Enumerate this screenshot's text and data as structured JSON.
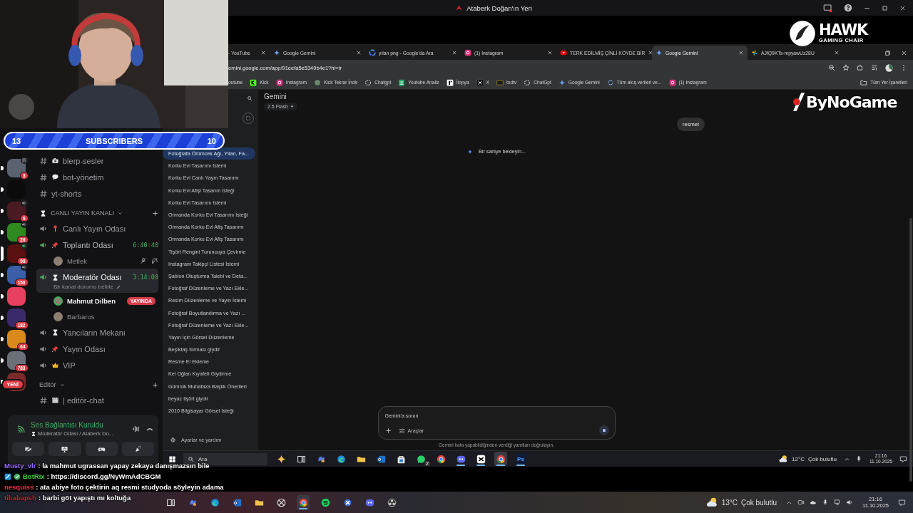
{
  "title_bar": {
    "title": "Ataberk Doğan'ın Yeri"
  },
  "subscribers_bar": {
    "left_count": "13",
    "label": "SUBSCRIBERS",
    "right_count": "10"
  },
  "sponsor_logos": [
    {
      "kind": "hawk",
      "name": "HAWK",
      "tagline": "GAMING CHAIR"
    },
    {
      "kind": "bynogame",
      "name": "ByNoGame"
    }
  ],
  "browser": {
    "tabs": [
      {
        "title": "- YouTube",
        "selected": false
      },
      {
        "title": "Google Gemini",
        "icon": {
          "kind": "gemini"
        },
        "selected": false
      },
      {
        "title": "yılan png - Google'da Ara",
        "icon": {
          "kind": "google"
        },
        "selected": false
      },
      {
        "title": "(1) Instagram",
        "icon": {
          "kind": "instagram"
        },
        "selected": false
      },
      {
        "title": "TERK EDİLMİŞ ÇİNLİ KÖYDE BİR",
        "icon": {
          "kind": "youtube"
        },
        "selected": false
      },
      {
        "title": "Google Gemini",
        "icon": {
          "kind": "gemini"
        },
        "selected": true
      },
      {
        "title": "AJfQ9KTs-mpyawUz28U",
        "icon": {
          "kind": "photos"
        },
        "selected": false
      }
    ],
    "url": "emini.google.com/app/91eefa5e5349b4e1?hl=tr",
    "bookmarks": [
      {
        "label": "outube"
      },
      {
        "label": "Kick",
        "icon": {
          "kind": "kick"
        }
      },
      {
        "label": "Instagram",
        "icon": {
          "kind": "instagram"
        }
      },
      {
        "label": "Kick Tekrar İndir",
        "icon": {
          "kind": "circle"
        }
      },
      {
        "label": "Chatgpt",
        "icon": {
          "kind": "chatgpt"
        }
      },
      {
        "label": "Youtube Analiz",
        "icon": {
          "kind": "sheets"
        }
      },
      {
        "label": "İtopya",
        "icon": {
          "kind": "itopya"
        }
      },
      {
        "label": "X",
        "icon": {
          "kind": "x"
        }
      },
      {
        "label": "todtv",
        "icon": {
          "kind": "todtv"
        }
      },
      {
        "label": "ChatGpt",
        "icon": {
          "kind": "chatgpt"
        }
      },
      {
        "label": "Google Gemini",
        "icon": {
          "kind": "gemini"
        }
      },
      {
        "label": "Tüm akış verileri ve...",
        "icon": {
          "kind": "sync"
        }
      },
      {
        "label": "(1) Instagram",
        "icon": {
          "kind": "instagram"
        }
      }
    ],
    "all_bookmarks": "Tüm Yer İşaretleri"
  },
  "discord": {
    "servers": [
      {
        "color": "#5b6270",
        "badge": "3",
        "indicator": {
          "kind": "screen"
        },
        "unread": true,
        "selected": false
      },
      {
        "color": "#0b0b0b",
        "unread": true,
        "selected": false
      },
      {
        "color": "#4a1a22",
        "badge": "6",
        "indicator": {
          "kind": "speaker"
        },
        "unread": true,
        "selected": false
      },
      {
        "color": "#2f8a1f",
        "badge": "26",
        "indicator": {
          "kind": "speaker"
        },
        "unread": true,
        "selected": false
      },
      {
        "color": "#5a1010",
        "badge": "98",
        "indicator": {
          "kind": "speaker-active"
        },
        "unread": false,
        "selected": true
      },
      {
        "color": "#3a5fa8",
        "badge": "150",
        "indicator": {
          "kind": "speaker"
        },
        "unread": true,
        "selected": false
      },
      {
        "color": "#e8405f",
        "unread": true,
        "selected": false
      },
      {
        "color": "#3b2a6b",
        "badge": "182",
        "unread": true,
        "selected": false
      },
      {
        "color": "#d98a1a",
        "badge": "64",
        "unread": true,
        "selected": false
      },
      {
        "color": "#6b6f78",
        "badge": "783",
        "unread": true,
        "selected": false
      },
      {
        "color": "#7a2a2a",
        "new_label": "YENİ",
        "unread": true,
        "selected": false
      }
    ],
    "channels": [
      {
        "kind": "text",
        "name": "blerp-sesler",
        "emblem": {
          "kind": "camera"
        }
      },
      {
        "kind": "text",
        "name": "bot-yönetim",
        "emblem": {
          "kind": "speech"
        }
      },
      {
        "kind": "text",
        "name": "yt-shorts"
      },
      {
        "kind": "category",
        "name": "CANLI YAYIN KANALI",
        "emblem": {
          "kind": "hourglass"
        },
        "expanded": true
      },
      {
        "kind": "voice",
        "name": "Canlı Yayın Odası",
        "emblem": {
          "kind": "pin"
        },
        "active": false,
        "selected": false
      },
      {
        "kind": "voice",
        "name": "Toplantı Odası",
        "emblem": {
          "kind": "pushpin"
        },
        "active": true,
        "selected": false,
        "timer": "6:40:40",
        "members": [
          {
            "name": "Metlek",
            "speaking": false,
            "muted": true
          }
        ]
      },
      {
        "kind": "voice",
        "name": "Moderatör Odası",
        "emblem": {
          "kind": "hourglass"
        },
        "active": true,
        "selected": true,
        "timer": "3:14:08",
        "status": "Bir kanal durumu belirle",
        "members": [
          {
            "name": "Mahmut Dilben",
            "speaking": true,
            "muted": false,
            "live": "YAYINDA"
          },
          {
            "name": "Barbaros",
            "speaking": false,
            "muted": false
          }
        ]
      },
      {
        "kind": "voice",
        "name": "Yancıların Mekanı",
        "emblem": {
          "kind": "hourglass"
        },
        "active": false,
        "selected": false
      },
      {
        "kind": "voice",
        "name": "Yayın Odası",
        "emblem": {
          "kind": "pushpin"
        },
        "active": false,
        "selected": false
      },
      {
        "kind": "voice",
        "name": "VIP",
        "emblem": {
          "kind": "crown"
        },
        "active": false,
        "selected": false
      },
      {
        "kind": "category",
        "name": "Editör",
        "expanded": true
      },
      {
        "kind": "text",
        "name": "| editör-chat",
        "emblem": {
          "kind": "clapper"
        }
      }
    ],
    "voice_panel": {
      "title": "Ses Bağlantısı Kuruldu",
      "subtitle": "Moderatör Odası / Ataberk Do..."
    }
  },
  "gemini": {
    "history": [
      {
        "title": "Fotoğrafa Örümcek Ağı, Yılan, Fa...",
        "selected": true
      },
      {
        "title": "Korku Evi Tasarımı İstemi",
        "selected": false
      },
      {
        "title": "Korku Evi Canlı Yayın Tasarımı",
        "selected": false
      },
      {
        "title": "Korku Evi Afişi Tasarım İsteği",
        "selected": false
      },
      {
        "title": "Korku Evi Tasarımı İstemi",
        "selected": false
      },
      {
        "title": "Ormanda Korku Evi Tasarımı İsteği",
        "selected": false
      },
      {
        "title": "Ormanda Korku Evi Afiş Tasarımı",
        "selected": false
      },
      {
        "title": "Ormanda Korku Evi Afiş Tasarımı",
        "selected": false
      },
      {
        "title": "Tişört Rengini Turuncuya Çevirme",
        "selected": false
      },
      {
        "title": "Instagram Takipçi Listesi İstemi",
        "selected": false
      },
      {
        "title": "Şablon Oluşturma Talebi ve Deta...",
        "selected": false
      },
      {
        "title": "Fotoğraf Düzenleme ve Yazı Ekle...",
        "selected": false
      },
      {
        "title": "Resim Düzenleme ve Yayın İstemi",
        "selected": false
      },
      {
        "title": "Fotoğraf Boyutlandırma ve Yazı ...",
        "selected": false
      },
      {
        "title": "Fotoğraf Düzenleme ve Yazı Ekle...",
        "selected": false
      },
      {
        "title": "Yayın İçin Görsel Düzenleme",
        "selected": false
      },
      {
        "title": "Beşiktaş forması giydir",
        "selected": false
      },
      {
        "title": "Resme El Ekleme",
        "selected": false
      },
      {
        "title": "Kel Oğlan Kıyafeti Giydirme",
        "selected": false
      },
      {
        "title": "Gümrük Muhafaza Başlık Önerileri",
        "selected": false
      },
      {
        "title": "beyaz tişört giydir",
        "selected": false
      },
      {
        "title": "2010 Bilgisayar Görsel İsteği",
        "selected": false
      }
    ],
    "settings": "Ayarlar ve yardım",
    "title": "Gemini",
    "model": "2.5 Flash",
    "messages": [
      {
        "kind": "user",
        "text": "resmet"
      },
      {
        "kind": "model",
        "text": "Bir saniye bekleyin...",
        "loading": true
      }
    ],
    "input": {
      "placeholder": "Gemini'a sorun",
      "tools": "Araçlar"
    },
    "disclaimer": "Gemini hata yapabildiğinden verdiği yanıtları doğrulayın."
  },
  "inner_taskbar": {
    "search_placeholder": "Ara",
    "apps": [
      {
        "kind": "sparkle",
        "running": false,
        "active": false
      },
      {
        "kind": "taskview",
        "running": false,
        "active": false
      },
      {
        "kind": "copilot",
        "running": false,
        "active": false
      },
      {
        "kind": "edge",
        "running": false,
        "active": false
      },
      {
        "kind": "files",
        "running": false,
        "active": false
      },
      {
        "kind": "outlook",
        "running": false,
        "active": false
      },
      {
        "kind": "store",
        "running": false,
        "active": false
      },
      {
        "kind": "whatsapp",
        "badge": "2",
        "running": false,
        "active": false
      },
      {
        "kind": "chrome",
        "running": false,
        "active": false
      },
      {
        "kind": "discord",
        "running": true,
        "active": false
      },
      {
        "kind": "capcut",
        "running": true,
        "active": false
      },
      {
        "kind": "chrome",
        "running": true,
        "active": true
      },
      {
        "kind": "ps",
        "label": "Ps",
        "running": true,
        "active": false
      }
    ],
    "weather": {
      "temp": "12°C",
      "text": "Çok bulutlu"
    },
    "time": "21:16",
    "date": "11.10.2025"
  },
  "outer_taskbar": {
    "apps": [
      {
        "kind": "taskview",
        "running": false,
        "active": false
      },
      {
        "kind": "copilot",
        "running": false,
        "active": false
      },
      {
        "kind": "edge",
        "running": false,
        "active": false
      },
      {
        "kind": "outlook",
        "running": false,
        "active": false
      },
      {
        "kind": "files",
        "running": false,
        "active": false
      },
      {
        "kind": "xbox",
        "running": false,
        "active": false
      },
      {
        "kind": "chrome",
        "running": true,
        "active": true
      },
      {
        "kind": "spotify",
        "running": false,
        "active": false
      },
      {
        "kind": "game",
        "running": false,
        "active": false
      },
      {
        "kind": "discord",
        "running": false,
        "active": false
      },
      {
        "kind": "obs",
        "running": false,
        "active": false
      }
    ],
    "weather": {
      "temp": "13°C",
      "text": "Çok bulutlu"
    },
    "time": "21:16",
    "date": "11.10.2025"
  },
  "chat": [
    {
      "user": "Musty_vlr",
      "color": "#9b6cff",
      "message": ": la mahmut ugrassan yapay zekaya danışmazsın bile"
    },
    {
      "user": "BotRix",
      "color": "#3fd13f",
      "badges": [
        {
          "kind": "bot"
        },
        {
          "kind": "verified"
        }
      ],
      "message": ": https://discord.gg/NyWmAdCBGM"
    },
    {
      "user": "nesquiss",
      "color": "#e0344a",
      "message": ": ata abiye foto çektirin aq resmi studyoda söyleyin adama"
    },
    {
      "user": "tibabapsh",
      "color": "#c8283e",
      "message": ": barbi göt yapıştı mı koltuğa"
    }
  ]
}
